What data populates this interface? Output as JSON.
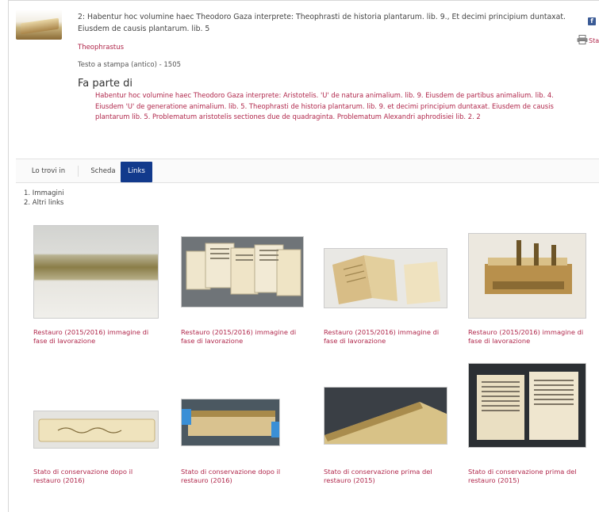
{
  "record": {
    "title": "2: Habentur hoc volumine haec Theodoro Gaza interprete: Theophrasti de historia plantarum. lib. 9., Et decimi principium duntaxat. Eiusdem de causis plantarum. lib. 5",
    "author": "Theophrastus",
    "type_line": "Testo a stampa (antico) - 1505",
    "part_of_label": "Fa parte di",
    "part_of_text": "Habentur hoc volumine haec Theodoro Gaza interprete: Aristotelis. 'U' de natura animalium. lib. 9. Eiusdem de partibus animalium. lib. 4. Eiusdem 'U' de generatione animalium. lib. 5. Theophrasti de historia plantarum. lib. 9. et decimi principium duntaxat. Eiusdem de causis plantarum lib. 5. Problematum aristotelis sectiones due de quadraginta. Problematum Alexandri aphrodisiei lib. 2. 2"
  },
  "share": {
    "facebook_icon": "f",
    "print_label": "Sta"
  },
  "tabs": [
    {
      "label": "Lo trovi in"
    },
    {
      "label": "Scheda"
    },
    {
      "label": "Links"
    }
  ],
  "links_list": [
    "1. Immagini",
    "2. Altri links"
  ],
  "gallery": [
    {
      "caption": "Restauro (2015/2016) immagine di fase di lavorazione"
    },
    {
      "caption": "Restauro (2015/2016) immagine di fase di lavorazione"
    },
    {
      "caption": "Restauro (2015/2016) immagine di fase di lavorazione"
    },
    {
      "caption": "Restauro (2015/2016) immagine di fase di lavorazione"
    },
    {
      "caption": "Stato di conservazione dopo il restauro (2016)"
    },
    {
      "caption": "Stato di conservazione dopo il restauro (2016)"
    },
    {
      "caption": "Stato di conservazione prima del restauro (2015)"
    },
    {
      "caption": "Stato di conservazione prima del restauro (2015)"
    }
  ],
  "colors": {
    "link": "#b0274b",
    "tab_active": "#123a8c",
    "facebook": "#3b5b96"
  }
}
